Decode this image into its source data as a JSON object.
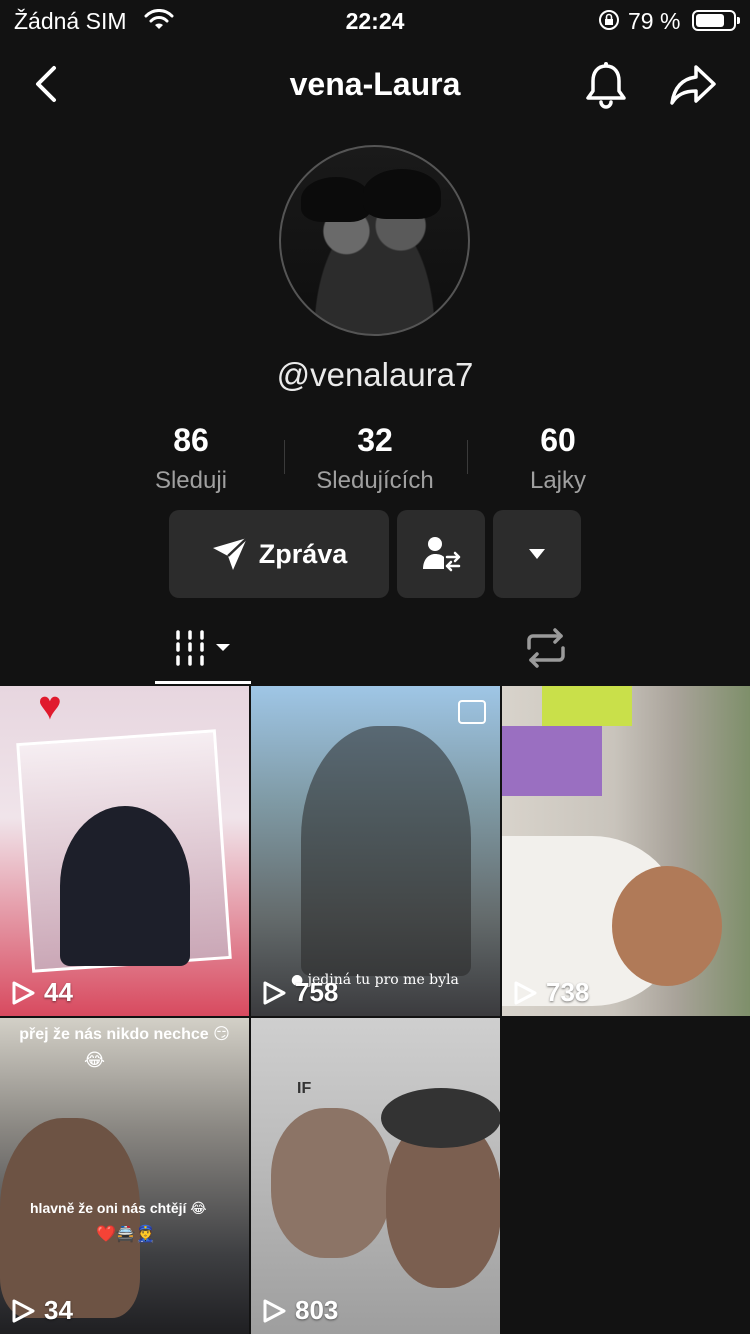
{
  "status_bar": {
    "carrier": "Žádná SIM",
    "time": "22:24",
    "battery_percent": "79 %",
    "battery_level": 0.79
  },
  "nav": {
    "title": "vena-Laura",
    "icons": [
      "back-chevron-icon",
      "bell-icon",
      "share-arrow-icon"
    ]
  },
  "profile": {
    "handle": "@venalaura7",
    "stats": [
      {
        "value": "86",
        "label": "Sleduji"
      },
      {
        "value": "32",
        "label": "Sledujících"
      },
      {
        "value": "60",
        "label": "Lajky"
      }
    ]
  },
  "actions": {
    "message_label": "Zpráva",
    "icons": [
      "send-icon",
      "follow-swap-icon",
      "dropdown-arrow-icon"
    ]
  },
  "tabs": {
    "icons": [
      "video-grid-icon",
      "repost-icon"
    ],
    "active": "videos"
  },
  "grid": {
    "videos": [
      {
        "views": "44"
      },
      {
        "views": "758",
        "caption": "● jediná tu pro me byla"
      },
      {
        "views": "738"
      },
      {
        "views": "34",
        "caption_top": "přej že nás nikdo nechce 😏",
        "caption_top_emoji": "😂",
        "caption_mid": "hlavně že oni nás chtějí 😂",
        "caption_mid_emoji": "❤️🚔👮"
      },
      {
        "views": "803",
        "overlay_text": "IF"
      }
    ]
  },
  "colors": {
    "background": "#121212",
    "button": "#2c2c2c",
    "secondary_text": "#a0a0a0"
  }
}
